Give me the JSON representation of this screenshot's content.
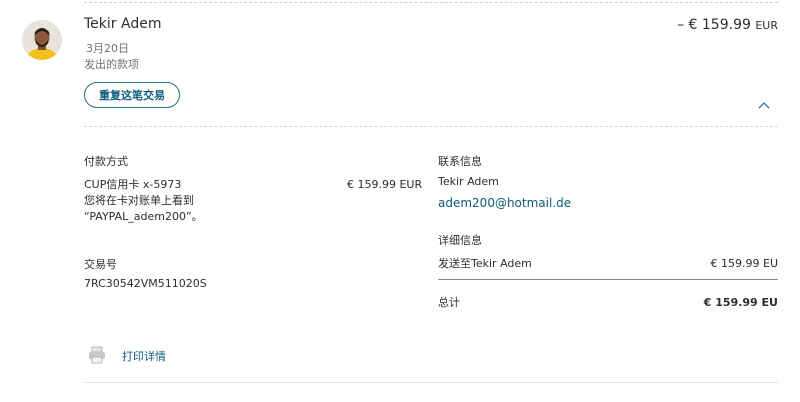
{
  "transaction": {
    "name": "Tekir Adem",
    "date": "3月20日",
    "type": "发出的款项",
    "amount": "– € 159.99",
    "currency": "EUR",
    "repeat_button": "重复这笔交易"
  },
  "payment": {
    "heading": "付款方式",
    "method": "CUP信用卡 x-5973",
    "note_line1": "您将在卡对账单上看到",
    "note_line2": "“PAYPAL_adem200”。",
    "amount": "€ 159.99 EUR"
  },
  "transaction_id": {
    "heading": "交易号",
    "value": "7RC30542VM511020S"
  },
  "contact": {
    "heading": "联系信息",
    "name": "Tekir Adem",
    "email": "adem200@hotmail.de"
  },
  "details": {
    "heading": "详细信息",
    "sent_to_label": "发送至Tekir Adem",
    "sent_to_amount": "€ 159.99 EU",
    "total_label": "总计",
    "total_amount": "€ 159.99 EU"
  },
  "print": {
    "label": "打印详情",
    "icon": "printer-icon"
  },
  "colors": {
    "accent": "#0e5c7d",
    "text": "#2c2e2f",
    "muted": "#6c7378"
  }
}
